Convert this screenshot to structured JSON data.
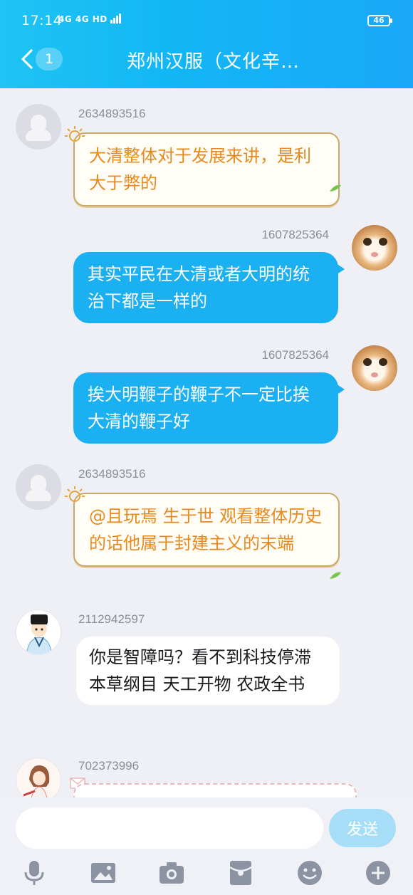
{
  "status_bar": {
    "time": "17:14",
    "network_label": "4G 4G HD",
    "battery": "46"
  },
  "nav": {
    "back_count": "1",
    "title": "郑州汉服（文化辛…"
  },
  "messages": [
    {
      "sender": "2634893516",
      "text": "大清整体对于发展来讲，是利大于弊的",
      "side": "left",
      "style": "gold"
    },
    {
      "sender": "1607825364",
      "text": "其实平民在大清或者大明的统治下都是一样的",
      "side": "right",
      "style": "blue"
    },
    {
      "sender": "1607825364",
      "text": "挨大明鞭子的鞭子不一定比挨大清的鞭子好",
      "side": "right",
      "style": "blue"
    },
    {
      "sender": "2634893516",
      "text": "@且玩焉 生于世  观看整体历史的话他属于封建主义的末端",
      "side": "left",
      "style": "gold"
    },
    {
      "sender": "2112942597",
      "text": "你是智障吗？看不到科技停滞 本草纲目 天工开物 农政全书",
      "side": "left",
      "style": "white"
    },
    {
      "sender": "702373996",
      "text": "",
      "side": "left",
      "style": "partial"
    }
  ],
  "input": {
    "placeholder": "",
    "send_label": "发送"
  },
  "toolbar": {
    "icons": [
      "microphone-icon",
      "image-icon",
      "camera-icon",
      "red-packet-icon",
      "emoji-icon",
      "plus-icon"
    ]
  },
  "colors": {
    "header": "#12b7f5",
    "blue_bubble": "#1ab0f2",
    "gold_text": "#e8891e",
    "send_button": "#a6def7"
  }
}
